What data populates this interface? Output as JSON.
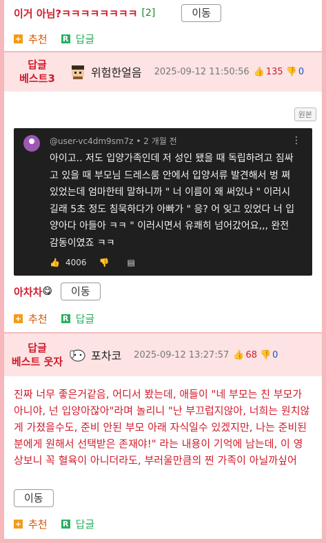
{
  "top": {
    "title": "이거 아님?ㅋㅋㅋㅋㅋㅋㅋㅋ",
    "count": "[2]",
    "move_label": "이동"
  },
  "actions": {
    "recommend": "추천",
    "reply": "답글"
  },
  "comment1": {
    "badge_line1": "답글",
    "badge_line2": "베스트3",
    "nick": "위험한얼음",
    "date": "2025-09-12 11:50:56",
    "likes": "135",
    "dislikes": "0",
    "original_label": "원본",
    "yt": {
      "user": "@user-vc4dm9sm7z",
      "time": "• 2 개월 전",
      "text": "아이고.. 저도 입양가족인데 저 성인 됐을 때 독립하려고 짐싸고 있을 때 부모님 드레스룸 안에서 입양서류 발견해서 벙 쪄있었는데 엄마한테 말하니까 \" 너 이름이 왜 써있냐 \" 이러시길래 5초 정도 침묵하다가 아빠가 \" 응? 어 잊고 있었다 너 입양아다 아들아 ㅋㅋ \" 이러시면서 유쾌히 넘어갔어요,,, 완전 감동이였죠 ㅋㅋ",
      "likes": "4006"
    },
    "body": "아차차",
    "emoji": "😋",
    "move_label": "이동"
  },
  "comment2": {
    "badge_line1": "답글",
    "badge_line2": "베스트 웃자",
    "nick": "포차코",
    "date": "2025-09-12 13:27:57",
    "likes": "68",
    "dislikes": "0",
    "body": "진짜 너무 좋은거같음, 어디서 봤는데, 애들이 \"네 부모는 친 부모가 아니야, 넌 입양아잖아\"라며 놀리니 \"난 부끄럽지않아, 너희는 원치않게 가졌을수도, 준비 안된 부모 아래 자식일수 있겠지만, 나는 준비된 분에게 원해서 선택받은 존재야!\" 라는 내용이 기억에 남는데, 이 영상보니 꼭 혈육이 아니더라도, 부러울만큼의 찐 가족이 아닐까싶어",
    "move_label": "이동"
  },
  "colors": {
    "accent": "#d11a2a",
    "band": "#fde3e3",
    "border": "#f6b8bd",
    "youtube_bg": "#1f1f1f"
  }
}
